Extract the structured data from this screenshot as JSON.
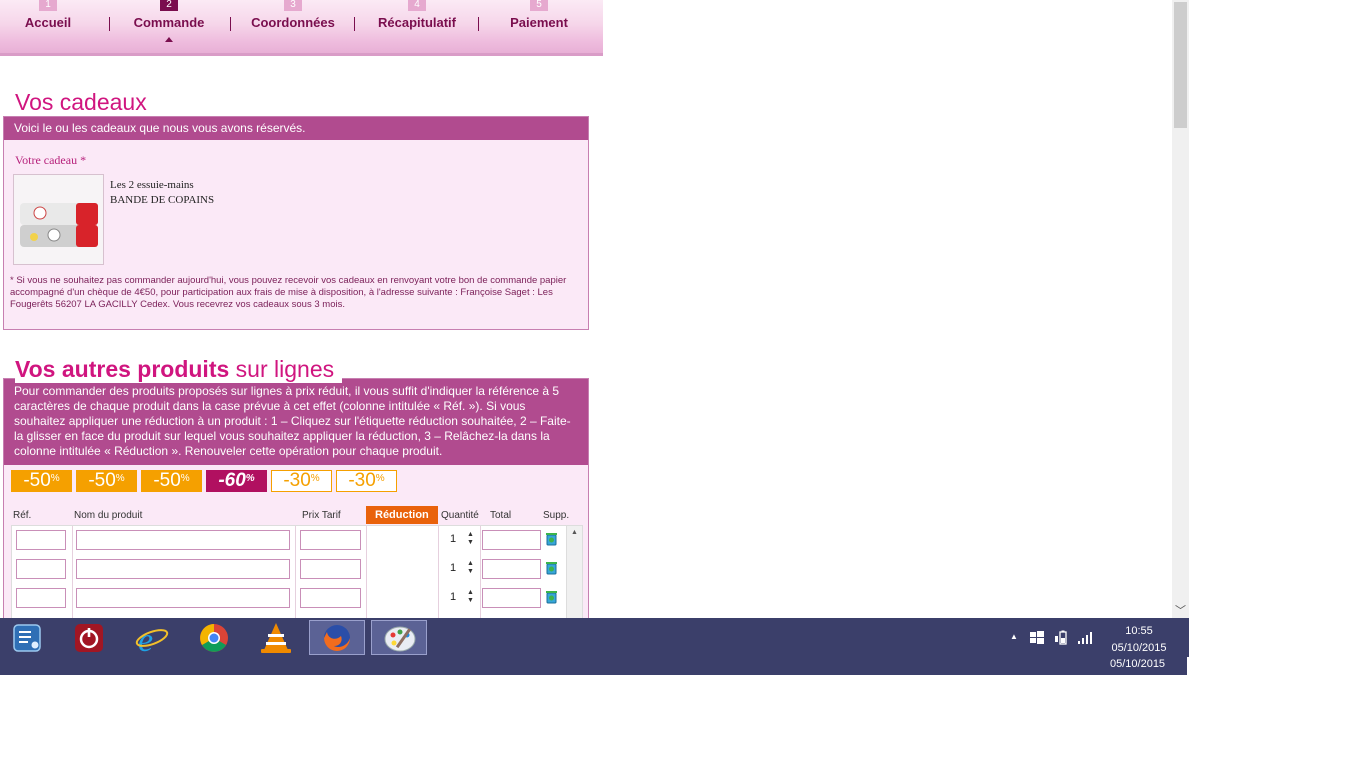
{
  "steps": [
    {
      "num": "1",
      "label": "Accueil"
    },
    {
      "num": "2",
      "label": "Commande"
    },
    {
      "num": "3",
      "label": "Coordonnées"
    },
    {
      "num": "4",
      "label": "Récapitulatif"
    },
    {
      "num": "5",
      "label": "Paiement"
    }
  ],
  "gifts": {
    "title": "Vos cadeaux",
    "intro": "Voici le ou les cadeaux que nous vous avons réservés.",
    "gift_label": "Votre cadeau *",
    "gift_name_line1": "Les 2 essuie-mains",
    "gift_name_line2": "BANDE DE COPAINS",
    "note": "* Si vous ne souhaitez pas commander aujourd'hui, vous pouvez recevoir vos cadeaux en renvoyant votre bon de commande papier accompagné d'un chèque de 4€50, pour participation aux frais de mise à disposition, à l'adresse suivante : Françoise Saget : Les Fougerêts 56207 LA GACILLY Cedex. Vous recevrez vos cadeaux sous 3 mois."
  },
  "products": {
    "title_bold": "Vos autres produits",
    "title_light": "sur lignes",
    "intro": "Pour commander des produits proposés sur lignes à prix réduit, il vous suffit d'indiquer la référence à 5 caractères de chaque produit dans la case prévue à cet effet (colonne intitulée « Réf. »). Si vous souhaitez appliquer une réduction à un produit : 1 – Cliquez sur l'étiquette réduction souhaitée, 2 – Faite-la glisser en face du produit sur lequel vous souhaitez appliquer la réduction, 3 – Relâchez-la dans la colonne intitulée « Réduction ». Renouveler cette opération pour chaque produit.",
    "discounts": [
      {
        "value": "-50",
        "unit": "%",
        "style": "orange"
      },
      {
        "value": "-50",
        "unit": "%",
        "style": "orange"
      },
      {
        "value": "-50",
        "unit": "%",
        "style": "orange"
      },
      {
        "value": "-60",
        "unit": "%",
        "style": "red"
      },
      {
        "value": "-30",
        "unit": "%",
        "style": "outline"
      },
      {
        "value": "-30",
        "unit": "%",
        "style": "outline"
      }
    ],
    "columns": {
      "ref": "Réf.",
      "name": "Nom du produit",
      "price": "Prix Tarif",
      "reduction": "Réduction",
      "quantity": "Quantité",
      "total": "Total",
      "delete": "Supp."
    },
    "rows": [
      {
        "ref": "",
        "name": "",
        "price": "",
        "quantity": "1",
        "total": ""
      },
      {
        "ref": "",
        "name": "",
        "price": "",
        "quantity": "1",
        "total": ""
      },
      {
        "ref": "",
        "name": "",
        "price": "",
        "quantity": "1",
        "total": ""
      }
    ]
  },
  "taskbar": {
    "apps": [
      "settings-app",
      "power",
      "internet-explorer",
      "chrome",
      "vlc",
      "firefox",
      "paint"
    ],
    "time": "10:55",
    "date": "05/10/2015",
    "ghost_date": "05/10/2015"
  },
  "colors": {
    "brand_pink": "#d0157f",
    "panel_header": "#b14b8f",
    "panel_bg": "#fbe9f7",
    "reduction_header": "#e9620b",
    "taskbar": "#3b3f6a"
  }
}
